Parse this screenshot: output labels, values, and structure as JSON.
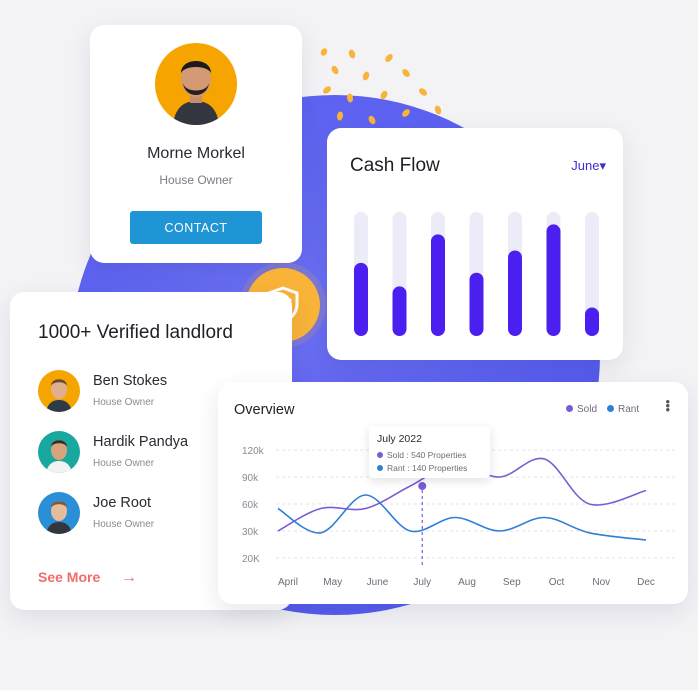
{
  "profile": {
    "name": "Morne Morkel",
    "role": "House Owner",
    "contact_label": "CONTACT"
  },
  "cash_flow": {
    "title": "Cash Flow",
    "month": "June▾",
    "bar_track_color": "#ecebf8",
    "bar_color": "#4a1ff0",
    "chart_data": {
      "type": "bar",
      "categories": [
        "",
        "",
        "",
        "",
        "",
        "",
        ""
      ],
      "values": [
        59,
        40,
        82,
        51,
        69,
        90,
        23
      ],
      "ylim": [
        0,
        100
      ],
      "grid": false
    }
  },
  "landlords": {
    "title": "1000+ Verified landlord",
    "people": [
      {
        "name": "Ben Stokes",
        "role": "House Owner",
        "color": "#f6a400"
      },
      {
        "name": "Hardik Pandya",
        "role": "House Owner",
        "color": "#19a8a0"
      },
      {
        "name": "Joe Root",
        "role": "House Owner",
        "color": "#2a8fd6"
      }
    ],
    "see_more": "See More",
    "arrow": "→"
  },
  "overview": {
    "title": "Overview",
    "legend": [
      {
        "name": "Sold",
        "color": "#7b5cd6"
      },
      {
        "name": "Rant",
        "color": "#2f7fd6"
      }
    ],
    "tooltip": {
      "title": "July 2022",
      "rows": [
        "Sold : 540 Properties",
        "Rant : 140 Properties"
      ]
    },
    "chart_data": {
      "type": "line",
      "x": [
        "April",
        "May",
        "June",
        "July",
        "Aug",
        "Sep",
        "Oct",
        "Nov",
        "Dec"
      ],
      "y_ticks": [
        "120k",
        "90k",
        "60k",
        "30k",
        "20K"
      ],
      "grid": true,
      "series": [
        {
          "name": "Sold",
          "color": "#7b5cd6",
          "values": [
            30000,
            55000,
            55000,
            80000,
            105000,
            90000,
            110000,
            60000,
            75000
          ]
        },
        {
          "name": "Rant",
          "color": "#2f7fd6",
          "values": [
            55000,
            28000,
            70000,
            30000,
            45000,
            30000,
            45000,
            28000,
            20000
          ]
        }
      ]
    }
  }
}
